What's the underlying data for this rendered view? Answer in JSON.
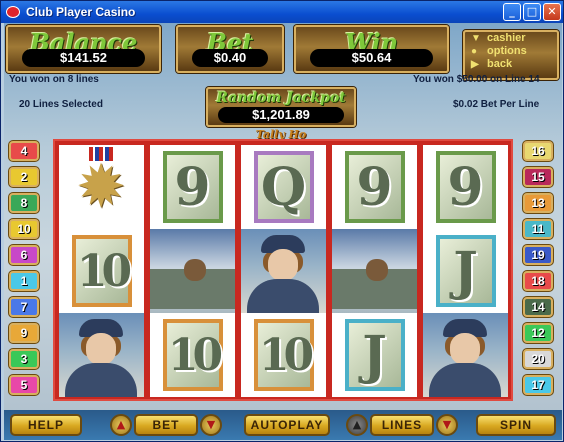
{
  "window": {
    "title": "Club Player Casino",
    "minimize": "_",
    "maximize": "□",
    "close": "✕"
  },
  "header": {
    "balance": {
      "label": "Balance",
      "value": "$141.52"
    },
    "bet": {
      "label": "Bet",
      "value": "$0.40"
    },
    "win": {
      "label": "Win",
      "value": "$50.64"
    },
    "menu": [
      "cashier",
      "options",
      "back"
    ]
  },
  "status": {
    "won_lines": "You won on 8 lines",
    "won_line_detail": "You won $50.00 on Line 14",
    "lines_selected": "20 Lines Selected",
    "bet_per_line": "$0.02 Bet Per Line"
  },
  "jackpot": {
    "label": "Random Jackpot",
    "value": "$1,201.89"
  },
  "game_title": "Tally Ho",
  "reels": [
    [
      "medal",
      "10",
      "pilot"
    ],
    [
      "9",
      "plane",
      "10"
    ],
    [
      "Q",
      "pilot",
      "10"
    ],
    [
      "9",
      "plane",
      "J"
    ],
    [
      "9",
      "J",
      "pilot"
    ]
  ],
  "left_lines": [
    "4",
    "2",
    "8",
    "10",
    "6",
    "1",
    "7",
    "9",
    "3",
    "5"
  ],
  "right_lines": [
    "16",
    "15",
    "13",
    "11",
    "19",
    "18",
    "14",
    "12",
    "20",
    "17"
  ],
  "line_colors": {
    "4": "#e84a4a",
    "2": "#e8c830",
    "8": "#3aa858",
    "10": "#e8c830",
    "6": "#c848c8",
    "1": "#4ac8e8",
    "7": "#4a78e8",
    "9": "#e8a838",
    "3": "#3ac858",
    "5": "#e848a8",
    "16": "#e8d870",
    "15": "#b8285a",
    "13": "#e89a38",
    "11": "#4ab8c8",
    "19": "#3a5ac8",
    "18": "#e84a4a",
    "14": "#4a6a4a",
    "12": "#3ac858",
    "20": "#d8d8d8",
    "17": "#4ac8e8"
  },
  "controls": {
    "help": "HELP",
    "bet": "BET",
    "autoplay": "AUTOPLAY",
    "lines": "LINES",
    "spin": "SPIN"
  }
}
